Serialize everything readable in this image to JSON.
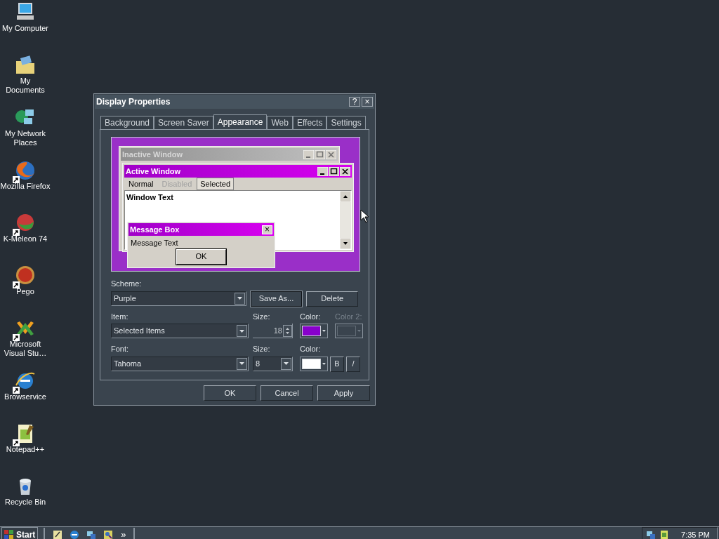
{
  "desktop_icons": [
    {
      "kind": "computer",
      "label": "My Computer",
      "shortcut": false
    },
    {
      "kind": "documents",
      "label": "My Documents",
      "shortcut": false
    },
    {
      "kind": "network",
      "label": "My Network Places",
      "shortcut": false
    },
    {
      "kind": "firefox",
      "label": "Mozilla Firefox",
      "shortcut": true
    },
    {
      "kind": "meleon",
      "label": "K-Meleon 74",
      "shortcut": true
    },
    {
      "kind": "ball",
      "label": "Pego",
      "shortcut": true
    },
    {
      "kind": "studio",
      "label": "Microsoft Visual Stu…",
      "shortcut": true
    },
    {
      "kind": "ie",
      "label": "Browservice",
      "shortcut": true
    },
    {
      "kind": "notepad",
      "label": "Notepad++",
      "shortcut": true
    },
    {
      "kind": "bin",
      "label": "Recycle Bin",
      "shortcut": false
    }
  ],
  "dialog": {
    "title": "Display Properties",
    "title_buttons": [
      "?",
      "×"
    ],
    "tabs": [
      {
        "label": "Background",
        "selected": false
      },
      {
        "label": "Screen Saver",
        "selected": false
      },
      {
        "label": "Appearance",
        "selected": true
      },
      {
        "label": "Web",
        "selected": false
      },
      {
        "label": "Effects",
        "selected": false
      },
      {
        "label": "Settings",
        "selected": false
      }
    ],
    "preview": {
      "inactive_title": "Inactive Window",
      "active_title": "Active Window",
      "menu": [
        {
          "label": "Normal",
          "disabled": false,
          "selected": false
        },
        {
          "label": "Disabled",
          "disabled": true,
          "selected": false
        },
        {
          "label": "Selected",
          "disabled": false,
          "selected": true
        }
      ],
      "window_text": "Window Text",
      "message_title": "Message Box",
      "message_close": "×",
      "message_text": "Message Text",
      "ok": "OK"
    },
    "scheme": {
      "label": "Scheme:",
      "value": "Purple",
      "buttons": [
        {
          "label": "Save As...",
          "focused": true
        },
        {
          "label": "Delete",
          "focused": false
        }
      ]
    },
    "item": {
      "label": "Item:",
      "value": "Selected Items",
      "size_label": "Size:",
      "size": "18",
      "color_label": "Color:",
      "color": "#8800cc",
      "color2_label": "Color 2:",
      "color2_disabled": true
    },
    "font": {
      "label": "Font:",
      "value": "Tahoma",
      "size_label": "Size:",
      "size": "8",
      "color_label": "Color:",
      "color": "#ffffff",
      "bold": "B",
      "italic": "/"
    },
    "buttons": [
      "OK",
      "Cancel",
      "Apply"
    ]
  },
  "taskbar": {
    "start": "Start",
    "quick_launch": [
      {
        "kind": "notes"
      },
      {
        "kind": "ie"
      },
      {
        "kind": "network"
      },
      {
        "kind": "search"
      }
    ],
    "more": "»",
    "tray": [
      {
        "kind": "network"
      },
      {
        "kind": "doc"
      }
    ],
    "clock": "7:35 PM"
  }
}
